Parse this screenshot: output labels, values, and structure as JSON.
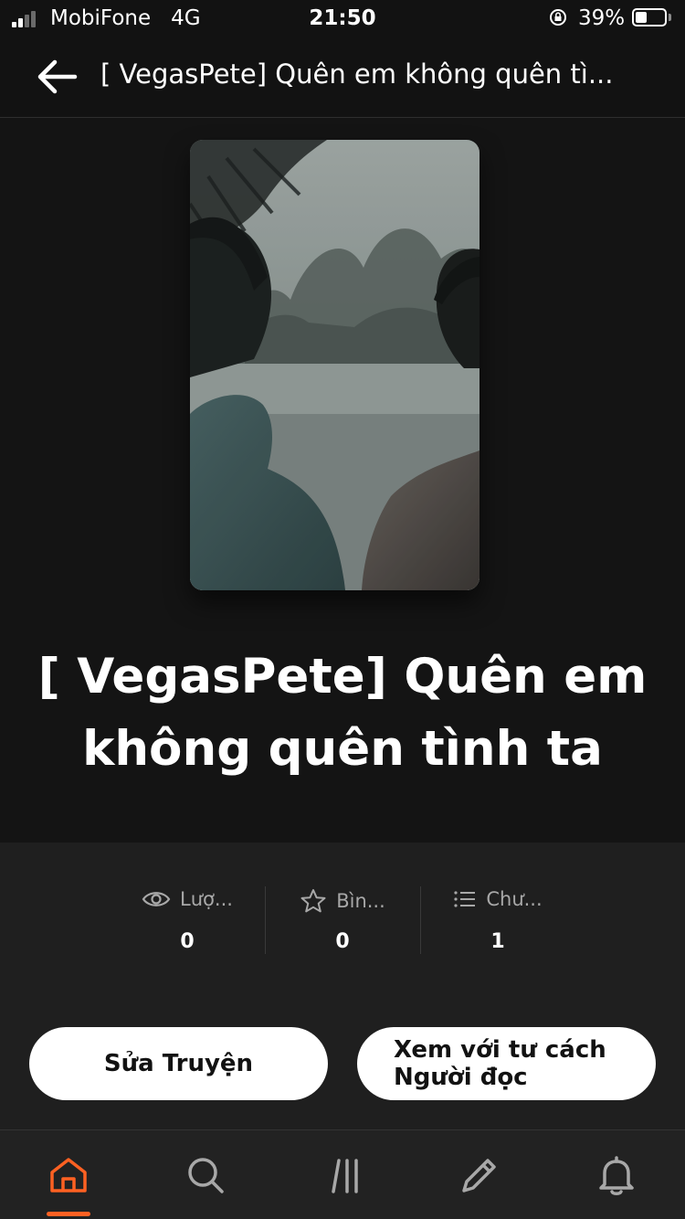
{
  "status_bar": {
    "carrier": "MobiFone",
    "network": "4G",
    "time": "21:50",
    "battery_percent": "39%",
    "battery_level": 0.39,
    "signal_bars_active": 2,
    "signal_bars_total": 4
  },
  "header": {
    "title": "[ VegasPete] Quên em không quên tì...",
    "back_icon": "arrow-left-icon"
  },
  "book": {
    "title": "[ VegasPete] Quên em không quên tình ta",
    "cover_icon": "book-cover-photo"
  },
  "stats": [
    {
      "icon": "eye-icon",
      "label": "Lượ...",
      "value": "0"
    },
    {
      "icon": "star-icon",
      "label": "Bìn...",
      "value": "0"
    },
    {
      "icon": "list-icon",
      "label": "Chư...",
      "value": "1"
    }
  ],
  "actions": {
    "edit_label": "Sửa Truyện",
    "view_as_reader_label": "Xem với tư cách Người đọc"
  },
  "bottom_nav": [
    {
      "icon": "home-icon",
      "active": true
    },
    {
      "icon": "search-icon",
      "active": false
    },
    {
      "icon": "library-icon",
      "active": false
    },
    {
      "icon": "pencil-icon",
      "active": false
    },
    {
      "icon": "bell-icon",
      "active": false
    }
  ],
  "colors": {
    "accent": "#ff6122",
    "background": "#121212",
    "panel": "#1f1f1f",
    "button": "#ffffff"
  }
}
